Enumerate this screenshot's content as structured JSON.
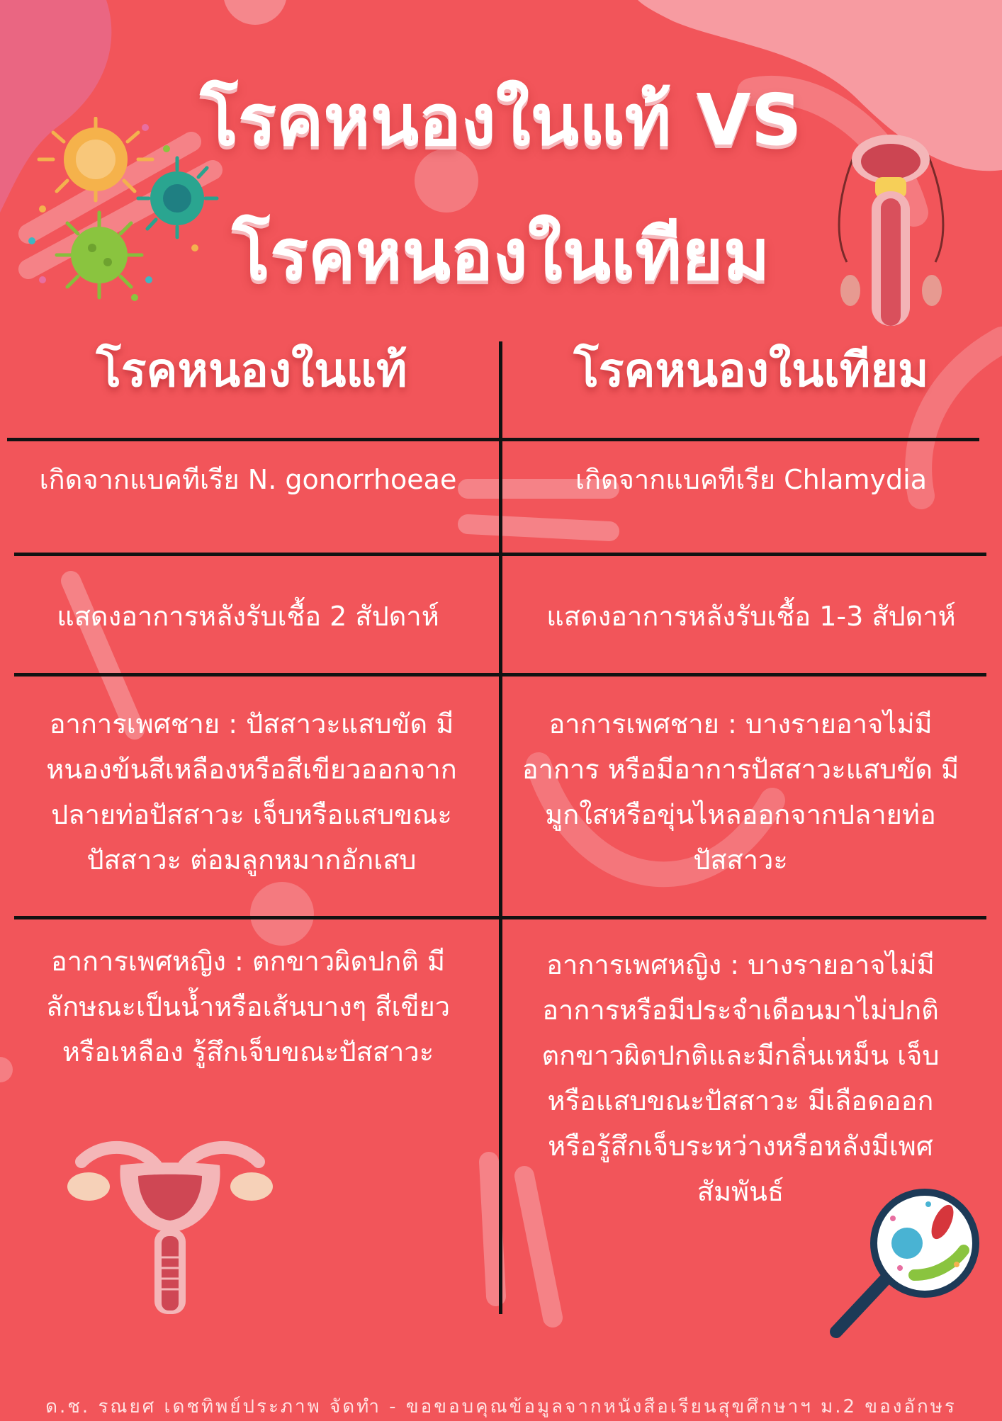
{
  "title": {
    "line1": "โรคหนองในแท้ VS",
    "line2": "โรคหนองในเทียม"
  },
  "columns": {
    "left_header": "โรคหนองในแท้",
    "right_header": "โรคหนองในเทียม"
  },
  "rows": [
    {
      "left": "เกิดจากแบคทีเรีย N. gonorrhoeae",
      "right": "เกิดจากแบคทีเรีย Chlamydia"
    },
    {
      "left": "แสดงอาการหลังรับเชื้อ 2 สัปดาห์",
      "right": "แสดงอาการหลังรับเชื้อ 1-3 สัปดาห์"
    },
    {
      "left": "อาการเพศชาย : ปัสสาวะแสบขัด มีหนองข้นสีเหลืองหรือสีเขียวออกจากปลายท่อปัสสาวะ เจ็บหรือแสบขณะปัสสาวะ ต่อมลูกหมากอักเสบ",
      "right": "อาการเพศชาย : บางรายอาจไม่มีอาการ หรือมีอาการปัสสาวะแสบขัด มีมูกใสหรือขุ่นไหลออกจากปลายท่อปัสสาวะ"
    },
    {
      "left": "อาการเพศหญิง : ตกขาวผิดปกติ มีลักษณะเป็นน้ำหรือเส้นบางๆ สีเขียวหรือเหลือง รู้สึกเจ็บขณะปัสสาวะ",
      "right": "อาการเพศหญิง : บางรายอาจไม่มีอาการหรือมีประจำเดือนมาไม่ปกติ ตกขาวผิดปกติและมีกลิ่นเหม็น เจ็บหรือแสบขณะปัสสาวะ มีเลือดออกหรือรู้สึกเจ็บระหว่างหรือหลังมีเพศสัมพันธ์"
    }
  ],
  "footer": "ด.ช. รณยศ เดชทิพย์ประภาพ จัดทำ - ขอขอบคุณข้อมูลจากหนังสือเรียนสุขศึกษาฯ ม.2 ของอักษร",
  "colors": {
    "background": "#f2555a",
    "divider": "#121212",
    "text": "#ffffff"
  },
  "icons": [
    "virus-cluster-icon",
    "male-reproductive-icon",
    "female-reproductive-icon",
    "magnifier-bacteria-icon"
  ]
}
